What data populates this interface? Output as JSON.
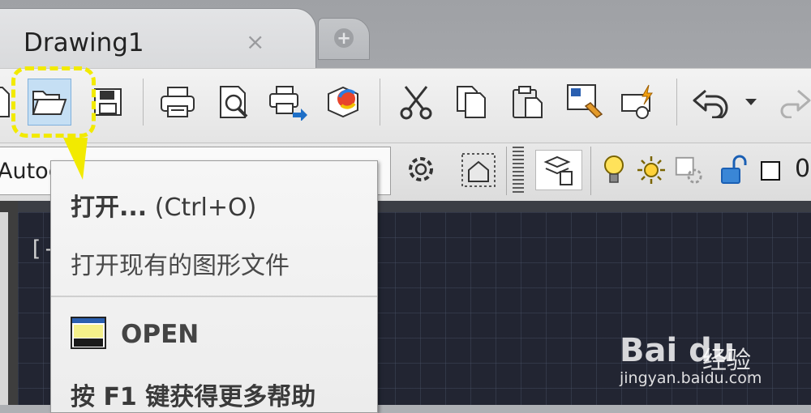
{
  "tab": {
    "title": "Drawing1",
    "close_glyph": "×",
    "new_tab_glyph": "+"
  },
  "toolbar": {
    "icons": [
      "new-icon",
      "open-folder-icon",
      "save-icon",
      "print-icon",
      "plot-preview-icon",
      "publish-icon",
      "3d-dwf-icon",
      "cut-icon",
      "copy-icon",
      "paste-icon",
      "match-properties-icon",
      "block-editor-icon",
      "undo-icon",
      "undo-dropdown-icon",
      "redo-icon"
    ]
  },
  "style_bar": {
    "combo_value": "Autodesk Classic",
    "combo_arrow": "▾"
  },
  "layers": {
    "layer_name": "0",
    "icons": [
      "layer-properties-icon",
      "lightbulb-icon",
      "sun-icon",
      "freeze-viewport-icon",
      "unlock-icon"
    ]
  },
  "viewport": {
    "label": "[-"
  },
  "tooltip": {
    "title_bold": "打开...",
    "title_shortcut": " (Ctrl+O)",
    "description": "打开现有的图形文件",
    "command": "OPEN",
    "help": "按 F1 键获得更多帮助"
  },
  "watermark": {
    "logo": "Bai du",
    "text": "经验",
    "url": "jingyan.baidu.com"
  },
  "colors": {
    "canvas": "#222532",
    "callout": "#f2ea00",
    "selected_button": "#c5dff4"
  }
}
